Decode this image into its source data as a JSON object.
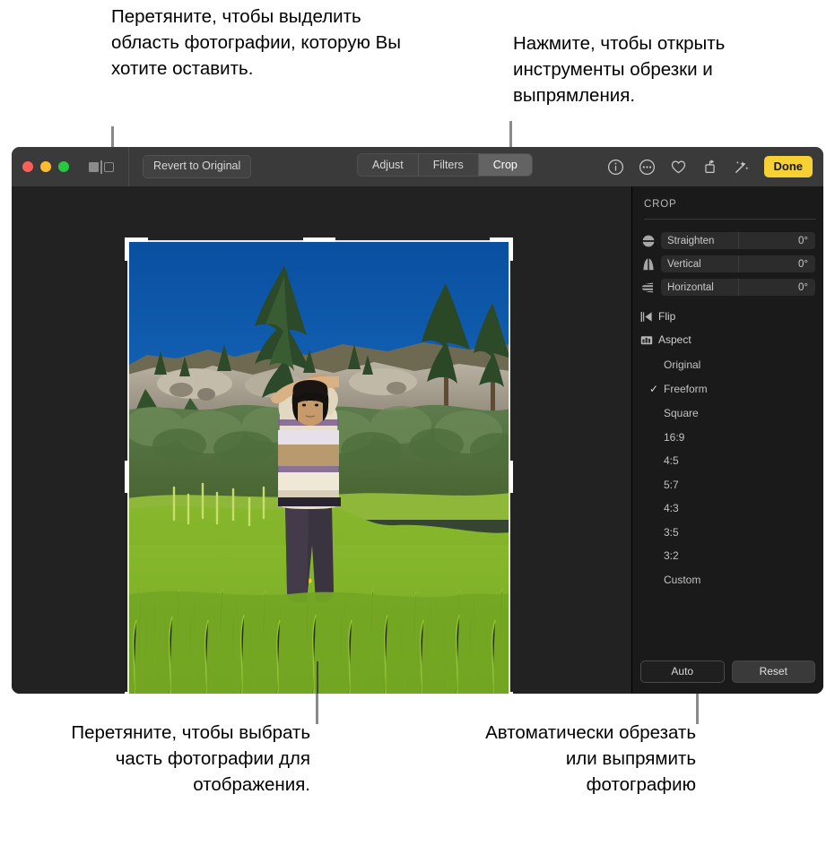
{
  "annotations": {
    "top_left": "Перетяните, чтобы выделить область фотографии, которую Вы хотите оставить.",
    "top_right": "Нажмите, чтобы открыть инструменты обрезки и выпрямления.",
    "bottom_left": "Перетяните, чтобы выбрать часть фотографии для отображения.",
    "bottom_right": "Автоматически обрезать или выпрямить фотографию"
  },
  "window": {
    "traffic_lights": [
      "close-button",
      "minimize-button",
      "zoom-button"
    ],
    "sidebar_toggle_icon": "sidebar-toggle-icon",
    "revert_label": "Revert to Original",
    "segments": [
      {
        "label": "Adjust",
        "active": false
      },
      {
        "label": "Filters",
        "active": false
      },
      {
        "label": "Crop",
        "active": true
      }
    ],
    "tools": [
      {
        "name": "info-icon"
      },
      {
        "name": "more-options-icon"
      },
      {
        "name": "favorite-heart-icon"
      },
      {
        "name": "rotate-icon"
      },
      {
        "name": "enhance-magic-wand-icon"
      }
    ],
    "done_label": "Done",
    "done_color": "#f7d033"
  },
  "panel": {
    "title": "CROP",
    "sliders": [
      {
        "icon": "straighten-icon",
        "label": "Straighten",
        "value": "0°"
      },
      {
        "icon": "vertical-perspective-icon",
        "label": "Vertical",
        "value": "0°"
      },
      {
        "icon": "horizontal-perspective-icon",
        "label": "Horizontal",
        "value": "0°"
      }
    ],
    "menus": [
      {
        "icon": "flip-icon",
        "label": "Flip"
      },
      {
        "icon": "aspect-icon",
        "label": "Aspect"
      }
    ],
    "aspect_options": [
      {
        "label": "Original",
        "checked": false
      },
      {
        "label": "Freeform",
        "checked": true
      },
      {
        "label": "Square",
        "checked": false
      },
      {
        "label": "16:9",
        "checked": false
      },
      {
        "label": "4:5",
        "checked": false
      },
      {
        "label": "5:7",
        "checked": false
      },
      {
        "label": "4:3",
        "checked": false
      },
      {
        "label": "3:5",
        "checked": false
      },
      {
        "label": "3:2",
        "checked": false
      },
      {
        "label": "Custom",
        "checked": false
      }
    ],
    "check_glyph": "✓",
    "auto_label": "Auto",
    "reset_label": "Reset"
  },
  "photo": {
    "description": "person-in-meadow-photo",
    "sky_color": "#0a4c96",
    "grass_color": "#7fae2a"
  }
}
